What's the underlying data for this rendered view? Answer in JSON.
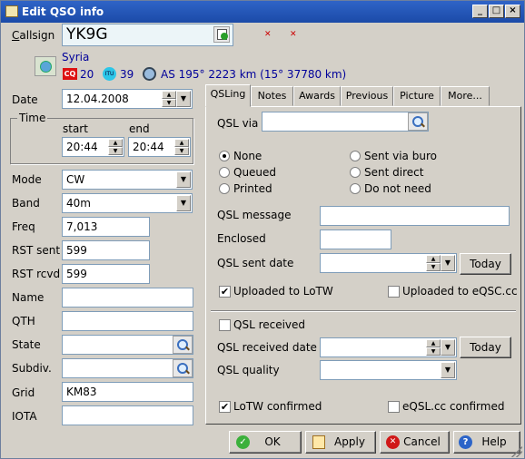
{
  "window": {
    "title": "Edit QSO info",
    "controls": [
      "_",
      "□",
      "×"
    ]
  },
  "callsign": {
    "label_pre": "",
    "label_u": "C",
    "label_post": "allsign",
    "value": "YK9G"
  },
  "country": {
    "name": "Syria",
    "cq_zone": "20",
    "itu_zone": "39",
    "bearing_info": "AS 195°  2223 km (15°  37780 km)"
  },
  "date": {
    "label": "Date",
    "value": "12.04.2008"
  },
  "time": {
    "group_label": "Time",
    "start_label": "start",
    "end_label": "end",
    "start": "20:44",
    "end": "20:44"
  },
  "fields": {
    "mode": {
      "label": "Mode",
      "value": "CW"
    },
    "band": {
      "label": "Band",
      "value": "40m"
    },
    "freq": {
      "label": "Freq",
      "value": "7,013"
    },
    "rst_sent": {
      "label": "RST sent",
      "value": "599"
    },
    "rst_rcvd": {
      "label": "RST rcvd",
      "value": "599"
    },
    "name": {
      "label": "Name",
      "value": ""
    },
    "qth": {
      "label": "QTH",
      "value": ""
    },
    "state": {
      "label": "State",
      "value": ""
    },
    "subdiv": {
      "label": "Subdiv.",
      "value": ""
    },
    "grid": {
      "label": "Grid",
      "value": "KM83"
    },
    "iota": {
      "label": "IOTA",
      "value": ""
    }
  },
  "tabs": [
    "QSLing",
    "Notes",
    "Awards",
    "Previous",
    "Picture",
    "More..."
  ],
  "qsl": {
    "via_label": "QSL via",
    "via_value": "",
    "radios": {
      "none": "None",
      "queued": "Queued",
      "printed": "Printed",
      "sent_via_buro": "Sent via buro",
      "sent_direct": "Sent direct",
      "do_not_need": "Do not need"
    },
    "selected": "None",
    "message_label": "QSL message",
    "enclosed_label": "Enclosed",
    "sent_date_label": "QSL sent date",
    "today_label": "Today",
    "uploaded_lotw": "Uploaded to LoTW",
    "uploaded_lotw_checked": true,
    "uploaded_eqsl": "Uploaded to eQSC.cc",
    "uploaded_eqsl_checked": false,
    "received_label": "QSL received",
    "received_checked": false,
    "received_date_label": "QSL received date",
    "quality_label": "QSL quality",
    "lotw_confirmed": "LoTW confirmed",
    "lotw_confirmed_checked": true,
    "eqsl_confirmed": "eQSL.cc confirmed",
    "eqsl_confirmed_checked": false
  },
  "buttons": {
    "ok": "OK",
    "apply": "Apply",
    "cancel": "Cancel",
    "help": "Help"
  },
  "colors": {
    "title_bar": "#2f64c7",
    "face": "#d4d0c8",
    "country_text": "#00009a",
    "callsign_bg": "#ecf5f8"
  }
}
